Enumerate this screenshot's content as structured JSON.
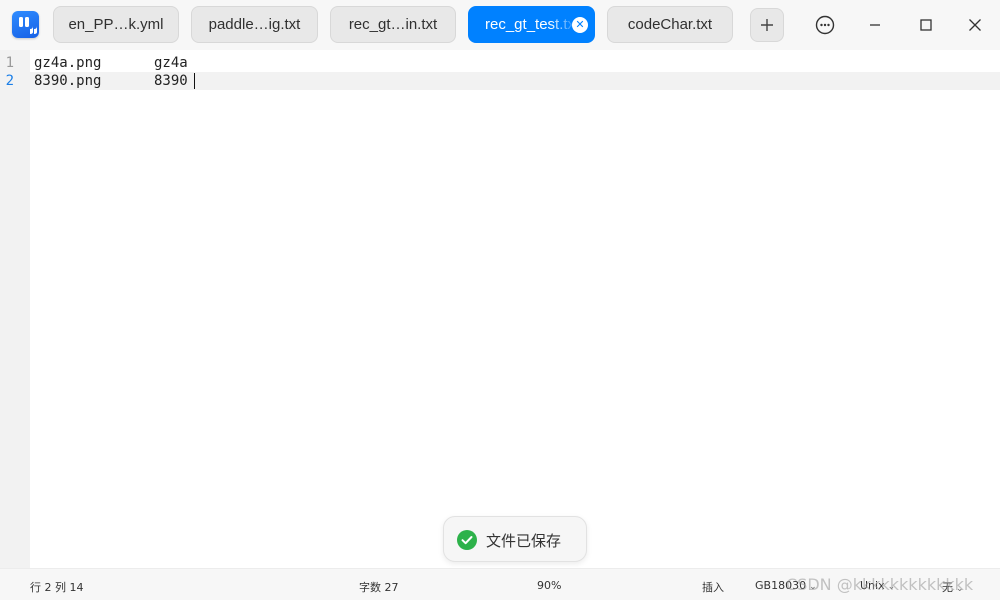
{
  "titlebar": {
    "tabs": [
      {
        "label": "en_PP…k.yml",
        "active": false
      },
      {
        "label": "paddle…ig.txt",
        "active": false
      },
      {
        "label": "rec_gt…in.txt",
        "active": false
      },
      {
        "label": "rec_gt_test.txt",
        "active": true
      },
      {
        "label": "codeChar.txt",
        "active": false
      }
    ],
    "add_tab_icon": "plus-icon",
    "menu_icon": "more-icon",
    "minimize_icon": "minimize-icon",
    "maximize_icon": "maximize-icon",
    "close_icon": "close-icon"
  },
  "editor": {
    "lines": [
      {
        "number": "1",
        "filename": "gz4a.png",
        "label": "gz4a"
      },
      {
        "number": "2",
        "filename": "8390.png",
        "label": "8390"
      }
    ],
    "current_line": 2
  },
  "toast": {
    "text": "文件已保存",
    "icon": "check-circle-icon"
  },
  "statusbar": {
    "position": "行 2  列 14",
    "char_count": "字数 27",
    "zoom": "90%",
    "mode": "插入",
    "encoding": "GB18030",
    "format": "Unix",
    "theme": "无"
  },
  "watermark": "CSDN @kkkkkkkkkkkkk",
  "colors": {
    "accent": "#0081ff",
    "success": "#2db24a",
    "current_line_number": "#1b7fe8"
  }
}
